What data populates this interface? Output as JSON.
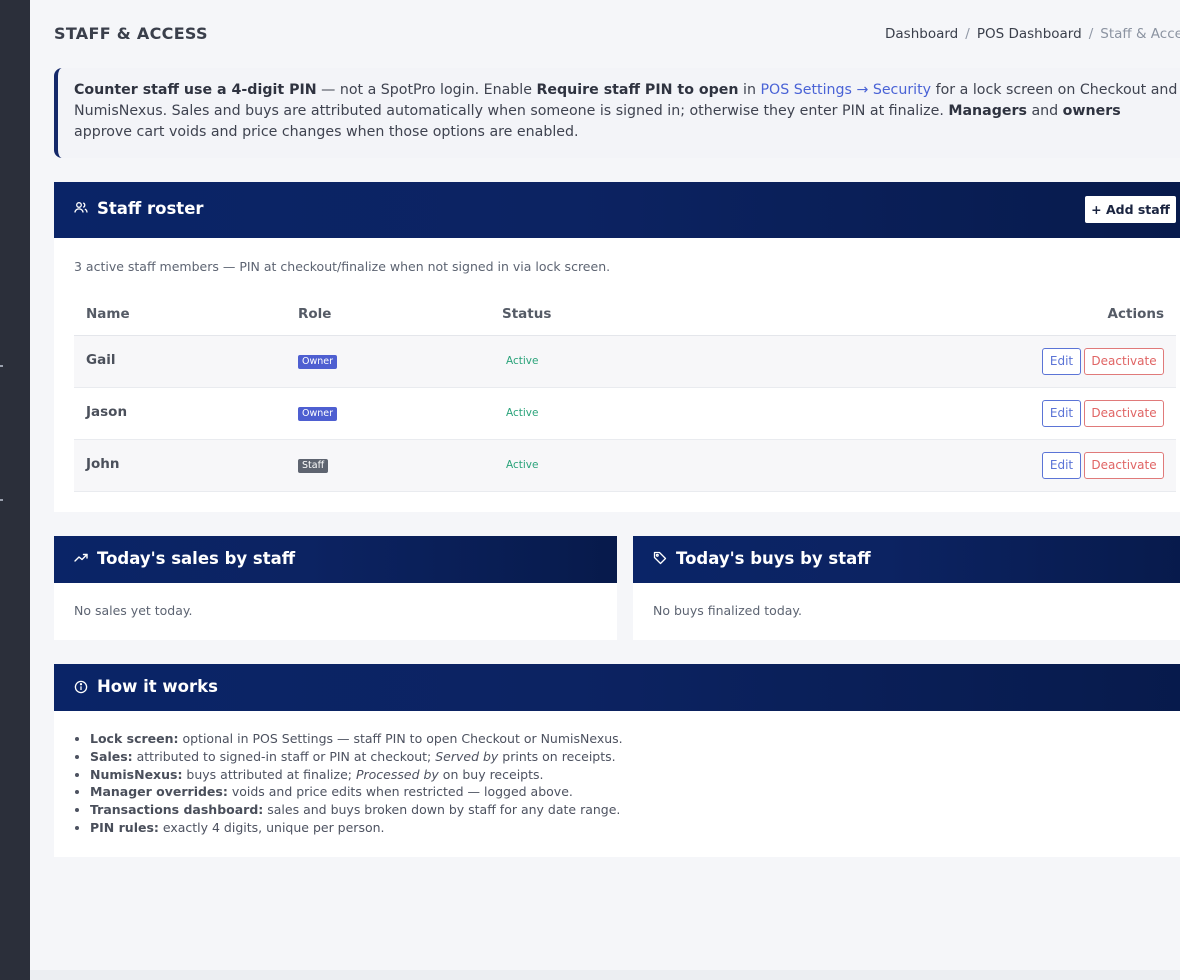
{
  "header": {
    "title": "STAFF & ACCESS",
    "breadcrumb": [
      "Dashboard",
      "POS Dashboard",
      "Staff & Access"
    ]
  },
  "callout": {
    "p1_b": "Counter staff use a 4-digit PIN",
    "p2": " — not a SpotPro login. Enable ",
    "p3_b": "Require staff PIN to open",
    "p4": " in ",
    "p5_link": "POS Settings → Security",
    "p6": " for a lock screen on Checkout and NumisNexus. Sales and buys are attributed automatically when someone is signed in; otherwise they enter PIN at finalize. ",
    "p7_b": "Managers",
    "p8": " and ",
    "p9_b": "owners",
    "p10": " approve cart voids and price changes when those options are enabled."
  },
  "roster": {
    "title": "Staff roster",
    "add_label": "+ Add staff",
    "subtitle": "3 active staff members — PIN at checkout/finalize when not signed in via lock screen.",
    "columns": [
      "Name",
      "Role",
      "Status",
      "Actions"
    ],
    "rows": [
      {
        "name": "Gail",
        "role": "Owner",
        "status": "Active",
        "edit": "Edit",
        "deactivate": "Deactivate"
      },
      {
        "name": "Jason",
        "role": "Owner",
        "status": "Active",
        "edit": "Edit",
        "deactivate": "Deactivate"
      },
      {
        "name": "John",
        "role": "Staff",
        "status": "Active",
        "edit": "Edit",
        "deactivate": "Deactivate"
      }
    ]
  },
  "sales": {
    "title": "Today's sales by staff",
    "empty": "No sales yet today."
  },
  "buys": {
    "title": "Today's buys by staff",
    "empty": "No buys finalized today."
  },
  "how": {
    "title": "How it works",
    "items": [
      {
        "b": "Lock screen:",
        "t": " optional in POS Settings — staff PIN to open Checkout or NumisNexus."
      },
      {
        "b": "Sales:",
        "t": " attributed to signed-in staff or PIN at checkout; ",
        "i": "Served by",
        "t2": " prints on receipts."
      },
      {
        "b": "NumisNexus:",
        "t": " buys attributed at finalize; ",
        "i": "Processed by",
        "t2": " on buy receipts."
      },
      {
        "b": "Manager overrides:",
        "t": " voids and price edits when restricted — logged above."
      },
      {
        "b": "Transactions dashboard:",
        "t": " sales and buys broken down by staff for any date range."
      },
      {
        "b": "PIN rules:",
        "t": " exactly 4 digits, unique per person."
      }
    ]
  },
  "icons": {
    "roster": "users-icon",
    "sales": "trending-up-icon",
    "buys": "tag-icon",
    "how": "info-icon"
  },
  "colors": {
    "header_gradient_start": "#0a2467",
    "header_gradient_end": "#071a4b",
    "accent_link": "#4a63d6",
    "active_green": "#2aa37a",
    "deactivate_red": "#e06464",
    "owner_badge": "#4e5fd1",
    "staff_badge": "#5e6470"
  }
}
